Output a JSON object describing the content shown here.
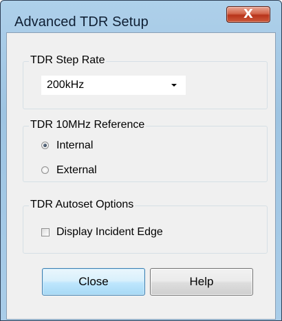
{
  "window": {
    "title": "Advanced TDR Setup",
    "close_glyph": "X"
  },
  "step_rate": {
    "legend": "TDR Step Rate",
    "selected": "200kHz"
  },
  "reference": {
    "legend": "TDR 10MHz Reference",
    "options": [
      {
        "label": "Internal",
        "checked": true
      },
      {
        "label": "External",
        "checked": false
      }
    ]
  },
  "autoset": {
    "legend": "TDR Autoset Options",
    "display_incident_edge": {
      "label": "Display Incident Edge",
      "checked": false
    }
  },
  "buttons": {
    "close_label": "Close",
    "help_label": "Help"
  },
  "icons": {
    "title_close": "close-icon",
    "dropdown": "chevron-down-icon"
  },
  "colors": {
    "titlebar": "#a9cde9",
    "client_bg": "#f0f0f0",
    "close_button": "#c9442a",
    "default_button_border": "#3c7fb1"
  }
}
